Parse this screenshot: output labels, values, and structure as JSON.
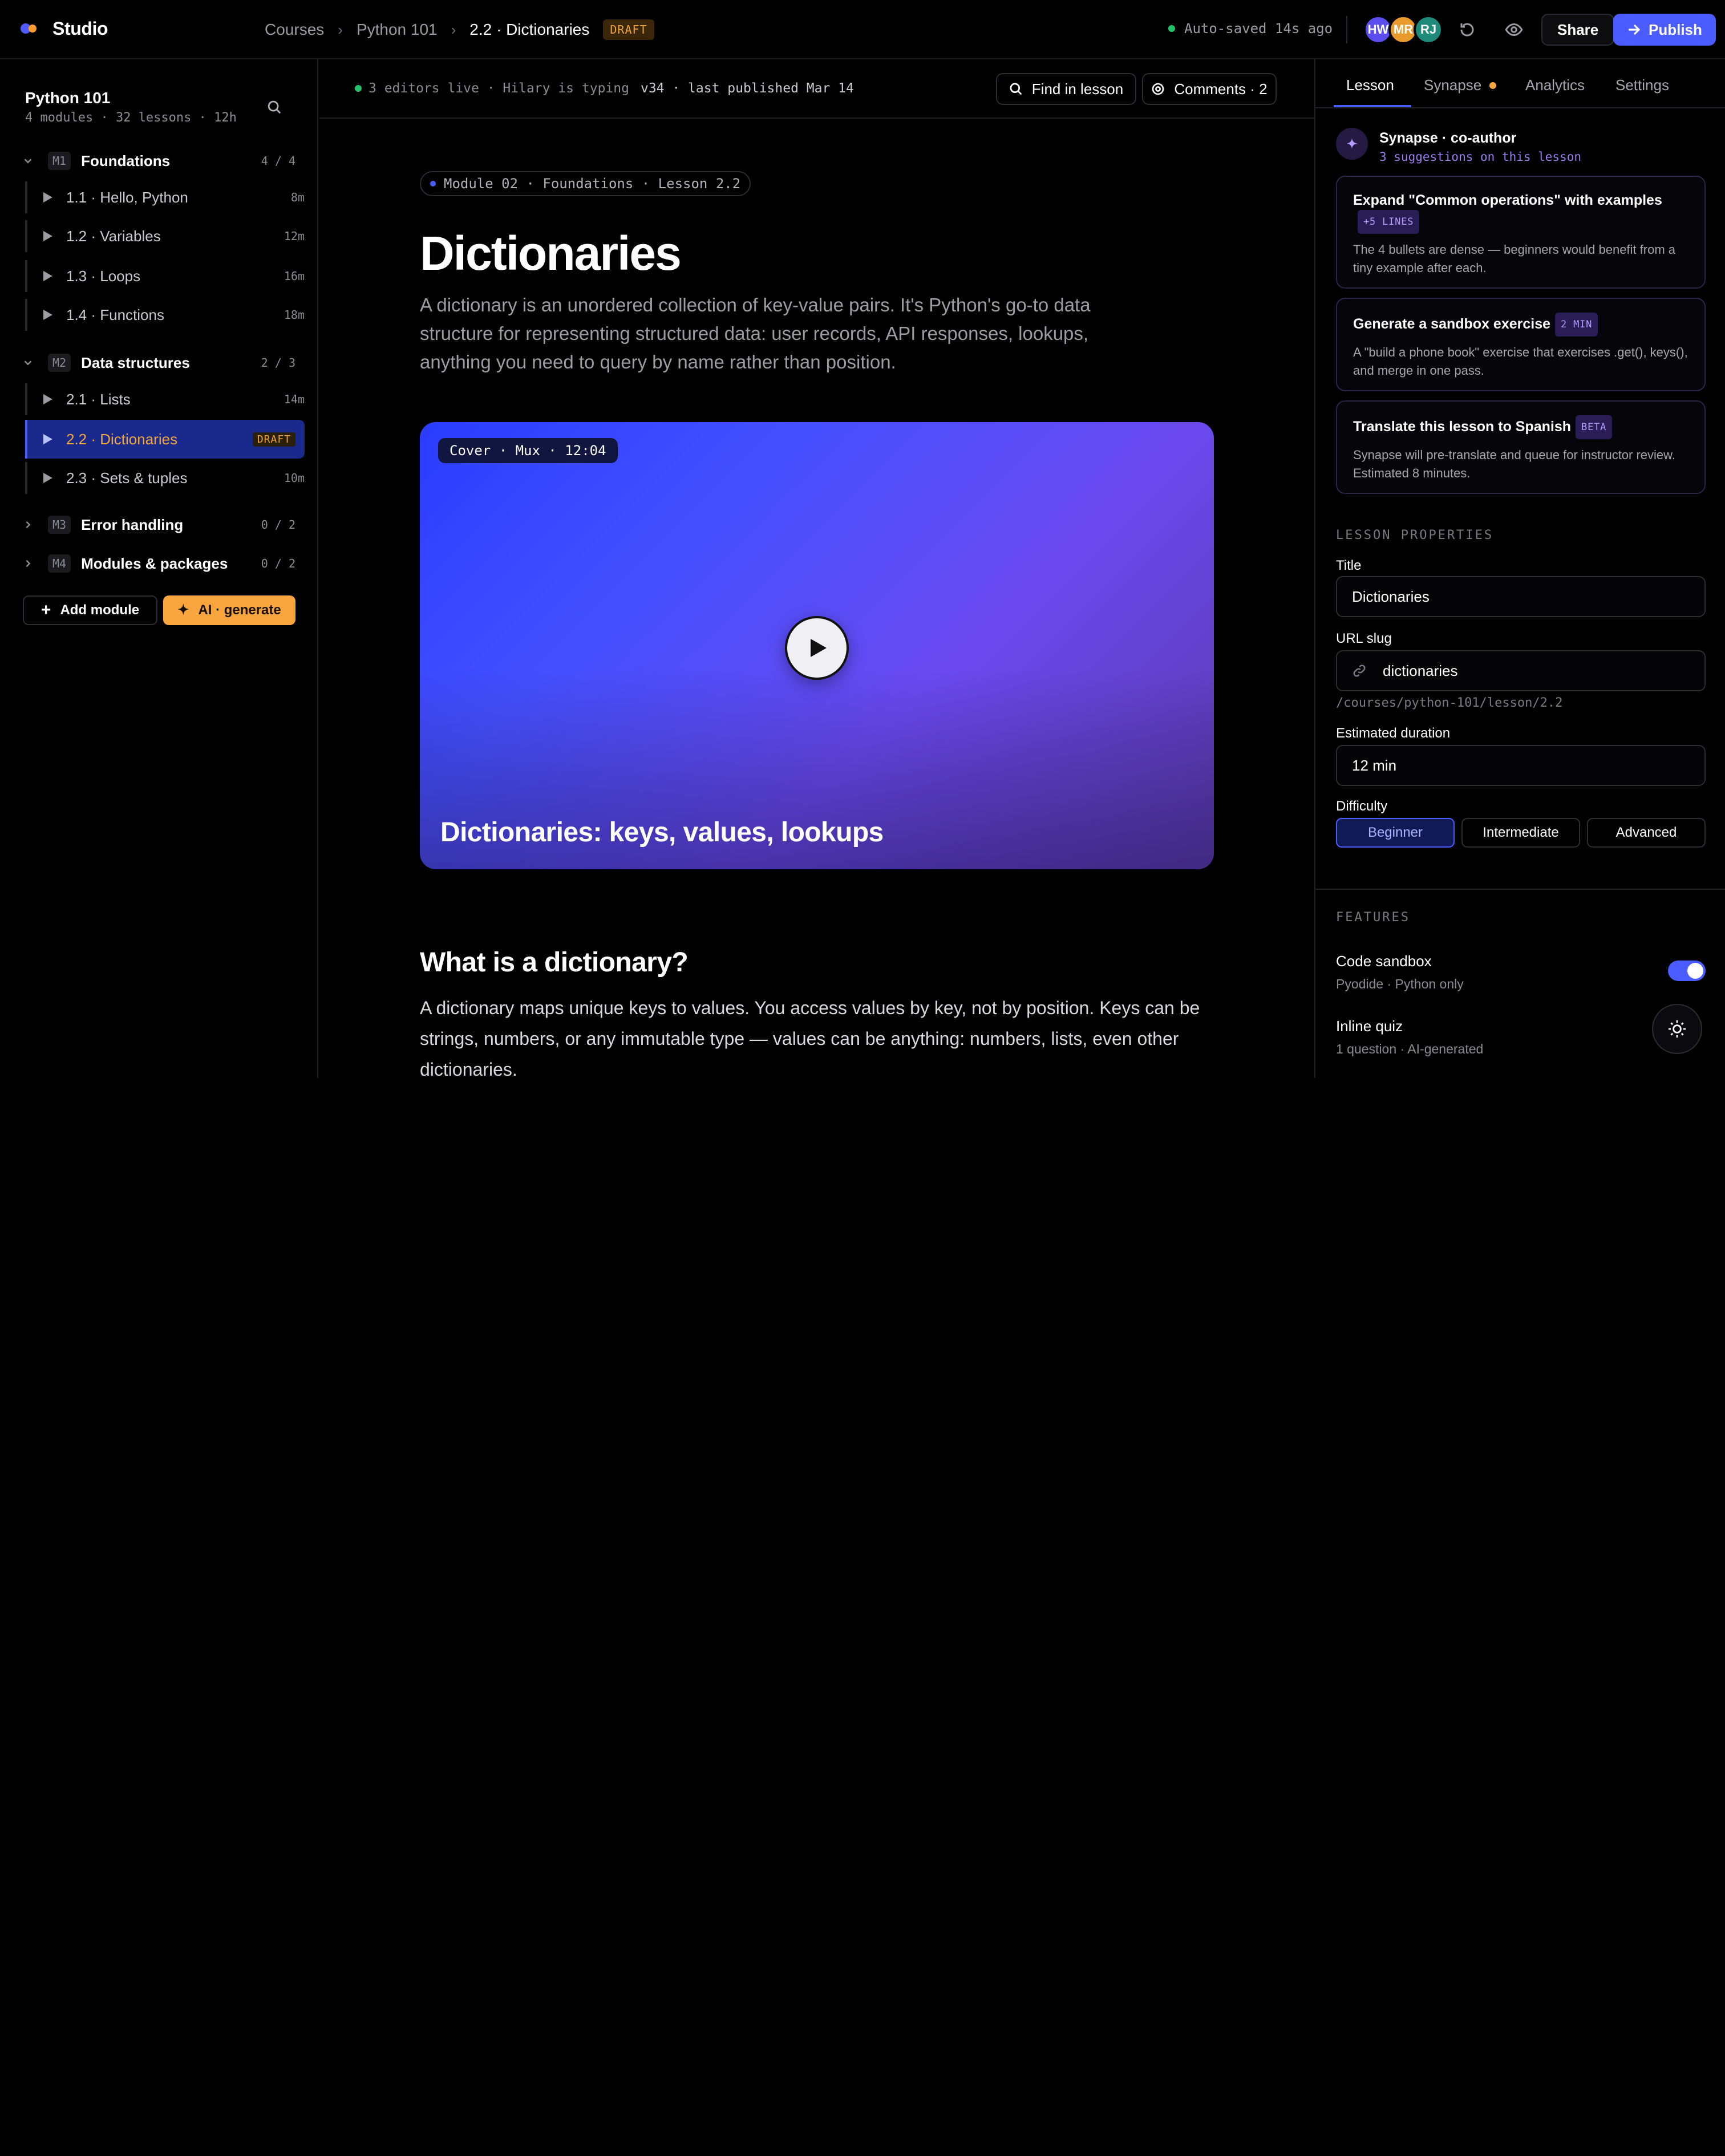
{
  "app": {
    "name": "Studio"
  },
  "breadcrumbs": {
    "root": "Courses",
    "course": "Python 101",
    "current": "2.2 · Dictionaries",
    "status": "DRAFT"
  },
  "topbar": {
    "autosave": "Auto-saved 14s ago",
    "avatars": [
      {
        "initials": "HW",
        "color": "#5b4cf0"
      },
      {
        "initials": "MR",
        "color": "#e89a2c"
      },
      {
        "initials": "RJ",
        "color": "#1f8a7a"
      }
    ],
    "share": "Share",
    "publish": "Publish",
    "icons": {
      "history": "history-icon",
      "preview": "eye-icon",
      "publish": "arrow-right-icon"
    }
  },
  "sidebar": {
    "title": "Python 101",
    "meta": "4 modules · 32 lessons · 12h",
    "modules": [
      {
        "tag": "M1",
        "name": "Foundations",
        "count": "4 / 4",
        "expanded": true,
        "lessons": [
          {
            "label": "1.1 · Hello, Python",
            "duration": "8m"
          },
          {
            "label": "1.2 · Variables",
            "duration": "12m"
          },
          {
            "label": "1.3 · Loops",
            "duration": "16m"
          },
          {
            "label": "1.4 · Functions",
            "duration": "18m"
          }
        ]
      },
      {
        "tag": "M2",
        "name": "Data structures",
        "count": "2 / 3",
        "expanded": true,
        "lessons": [
          {
            "label": "2.1 · Lists",
            "duration": "14m"
          },
          {
            "label": "2.2 · Dictionaries",
            "duration": "DRAFT"
          },
          {
            "label": "2.3 · Sets & tuples",
            "duration": "10m"
          }
        ]
      },
      {
        "tag": "M3",
        "name": "Error handling",
        "count": "0 / 2",
        "expanded": false
      },
      {
        "tag": "M4",
        "name": "Modules & packages",
        "count": "0 / 2",
        "expanded": false
      }
    ],
    "add_module": "Add module",
    "ai_generate": "AI · generate"
  },
  "editor": {
    "presence": "3 editors live · Hilary is typing",
    "version": "v34 · last published Mar 14",
    "find": "Find in lesson",
    "comments": "Comments · 2",
    "module_pill": "Module 02 · Foundations · Lesson 2.2",
    "title": "Dictionaries",
    "lede": "A dictionary is an unordered collection of key-value pairs. It's Python's go-to data structure for representing structured data: user records, API responses, lookups, anything you need to query by name rather than position.",
    "cover": {
      "tag": "Cover · Mux · 12:04",
      "caption": "Dictionaries: keys, values, lookups"
    },
    "section_heading": "What is a dictionary?",
    "section_body": "A dictionary maps unique keys to values. You access values by key, not by position. Keys can be strings, numbers, or any immutable type — values can be anything: numbers, lists, even other dictionaries."
  },
  "panel": {
    "tabs": [
      "Lesson",
      "Synapse",
      "Analytics",
      "Settings"
    ],
    "active_tab": "Lesson",
    "synapse": {
      "title": "Synapse · co-author",
      "subtitle": "3 suggestions on this lesson",
      "suggestions": [
        {
          "title": "Expand \"Common operations\" with examples",
          "tag": "+5 LINES",
          "body": "The 4 bullets are dense — beginners would benefit from a tiny example after each."
        },
        {
          "title": "Generate a sandbox exercise",
          "tag": "2 MIN",
          "body": "A \"build a phone book\" exercise that exercises .get(), keys(), and merge in one pass."
        },
        {
          "title": "Translate this lesson to Spanish",
          "tag": "BETA",
          "body": "Synapse will pre-translate and queue for instructor review. Estimated 8 minutes."
        }
      ]
    },
    "properties": {
      "section": "LESSON PROPERTIES",
      "title_label": "Title",
      "title_value": "Dictionaries",
      "slug_label": "URL slug",
      "slug_value": "dictionaries",
      "slug_path": "/courses/python-101/lesson/2.2",
      "duration_label": "Estimated duration",
      "duration_value": "12 min",
      "difficulty_label": "Difficulty",
      "difficulty_options": [
        "Beginner",
        "Intermediate",
        "Advanced"
      ],
      "difficulty_selected": "Beginner"
    },
    "features": {
      "section": "FEATURES",
      "items": [
        {
          "name": "Code sandbox",
          "sub": "Pyodide · Python only",
          "enabled": true
        },
        {
          "name": "Inline quiz",
          "sub": "1 question · AI-generated"
        }
      ]
    }
  },
  "colors": {
    "accent": "#4a5cff",
    "warning": "#f7a53c",
    "synapse": "#9b7ef0",
    "live": "#21c26b"
  }
}
